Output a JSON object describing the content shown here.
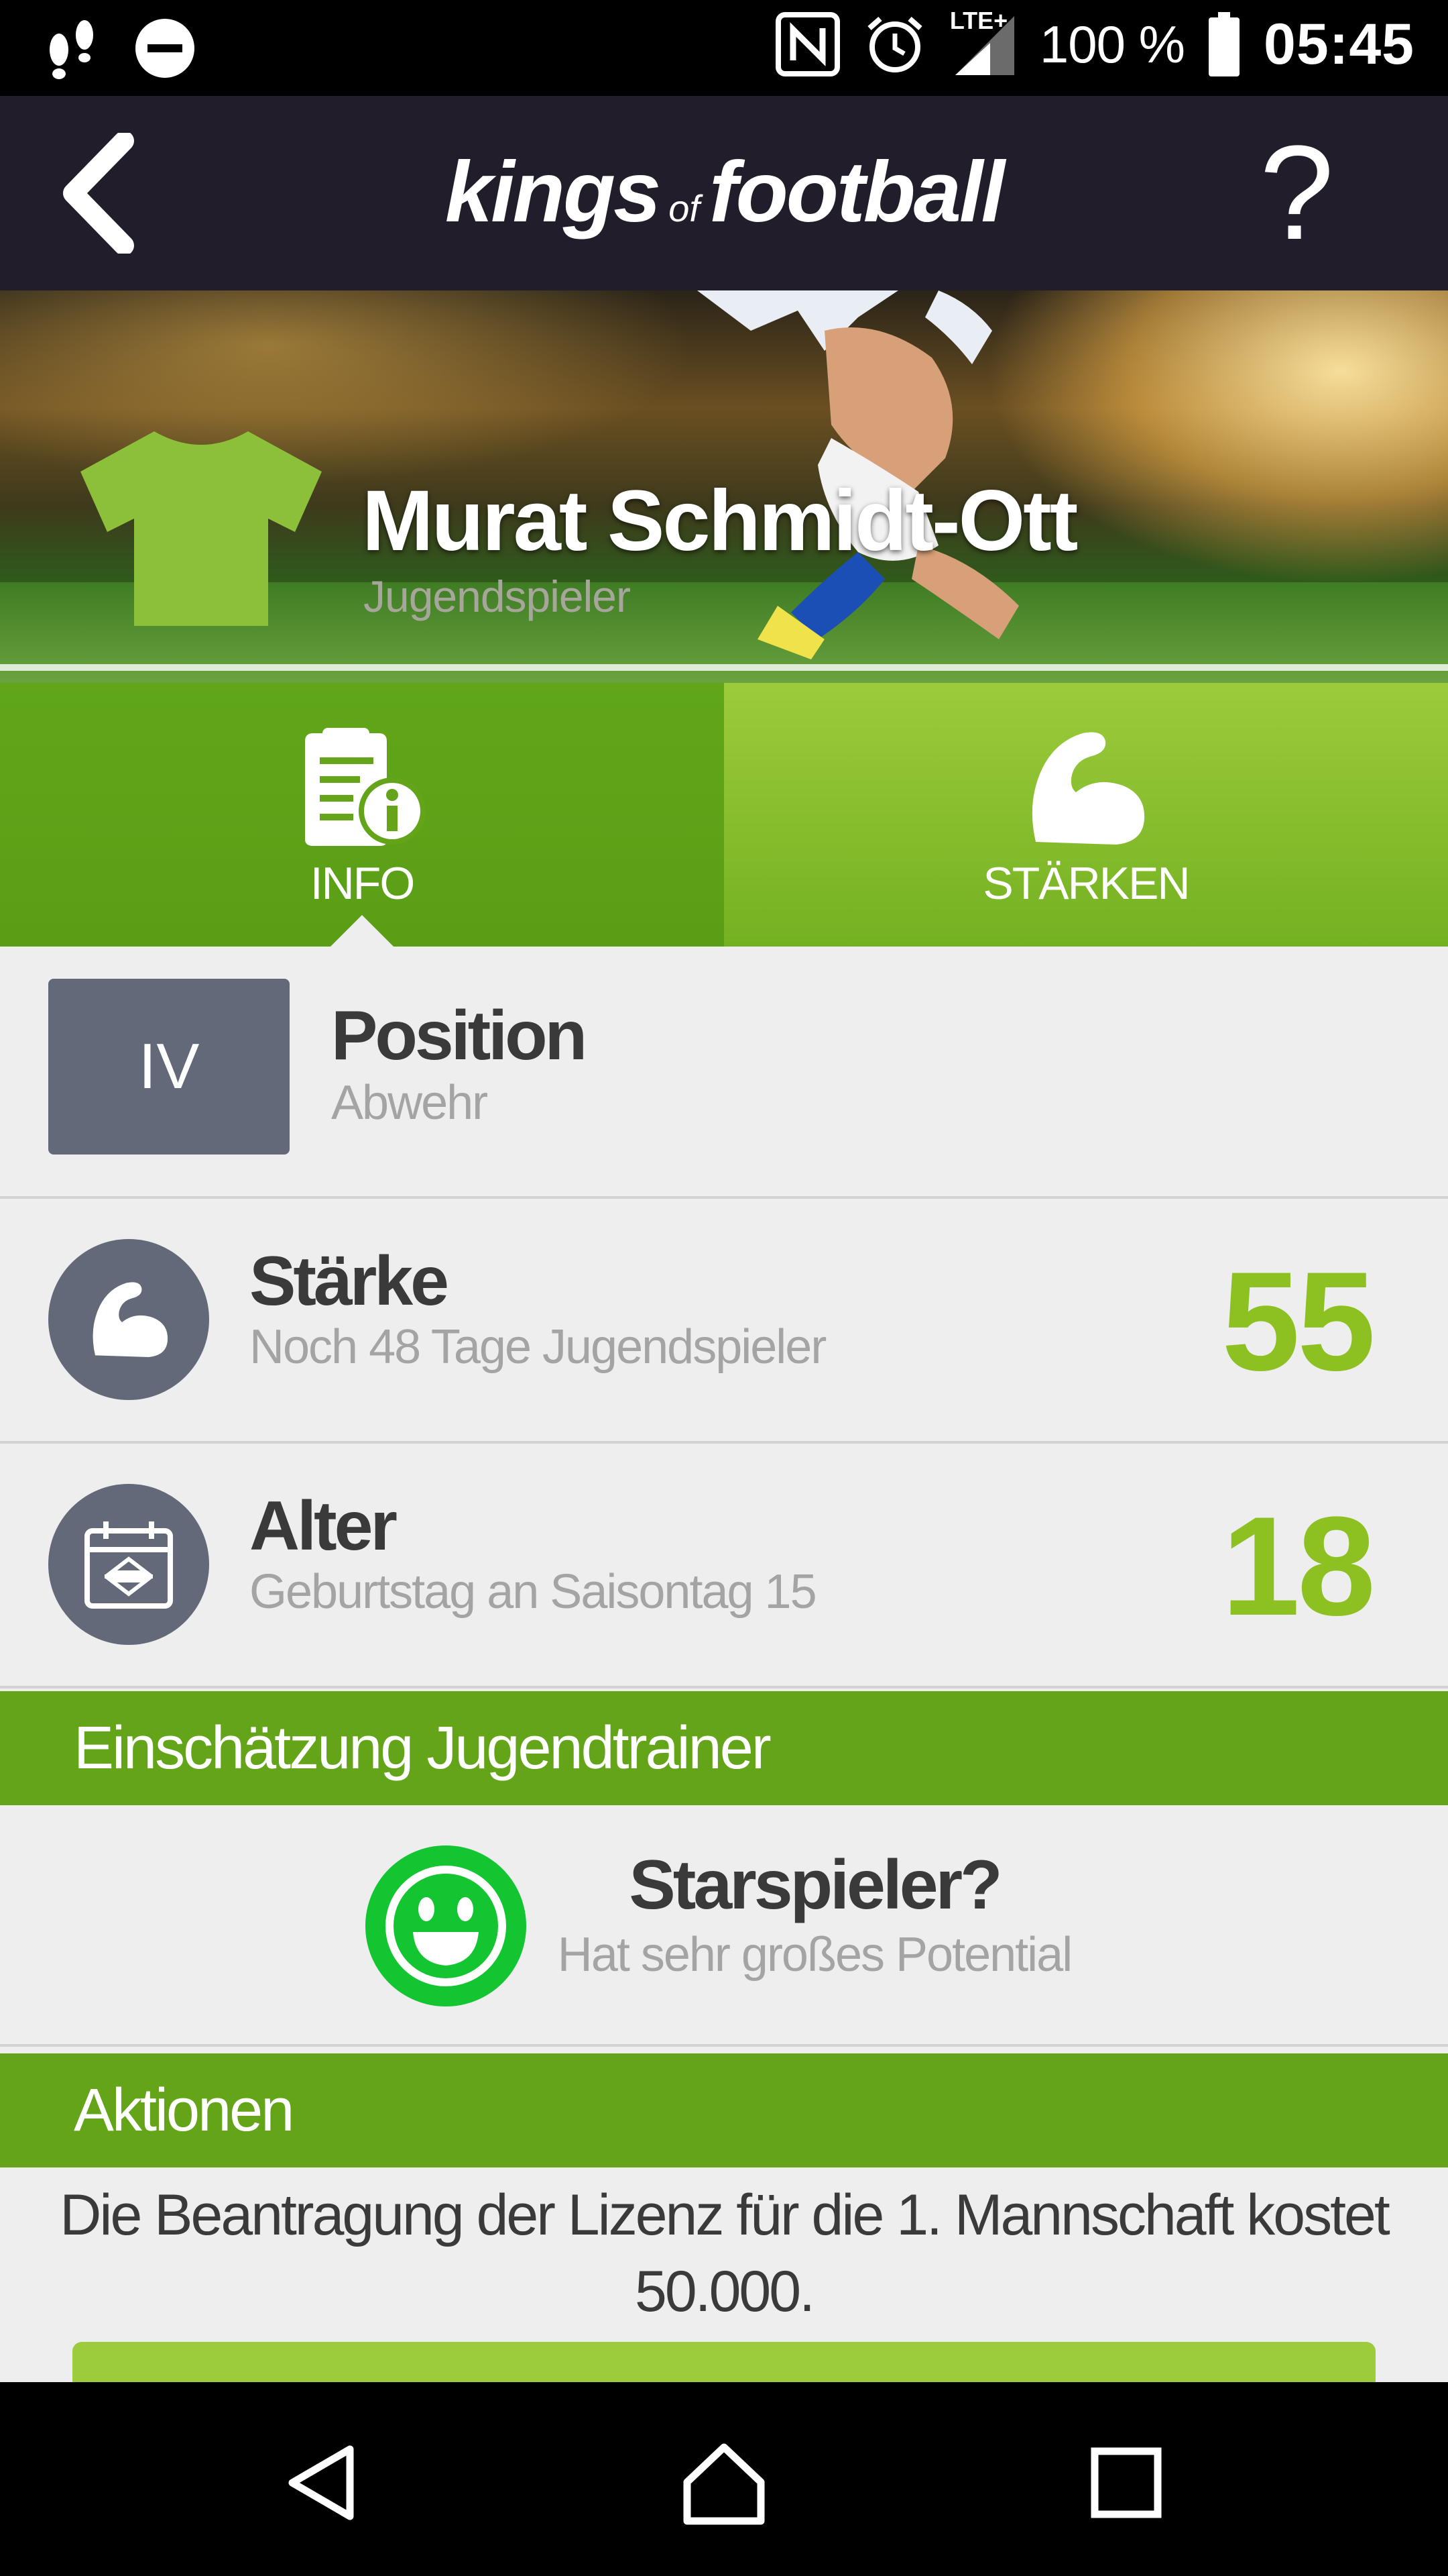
{
  "status_bar": {
    "battery_text": "100 %",
    "time": "05:45",
    "network_label": "LTE+",
    "icons": [
      "footsteps-icon",
      "do-not-disturb-icon",
      "nfc-icon",
      "alarm-icon",
      "signal-icon",
      "battery-icon"
    ]
  },
  "app_bar": {
    "logo_word1": "kings",
    "logo_word2": "of",
    "logo_word3": "football",
    "help_label": "?"
  },
  "player": {
    "name": "Murat Schmidt-Ott",
    "type": "Jugendspieler",
    "shirt_color": "#8dc03a"
  },
  "tabs": [
    {
      "label": "INFO",
      "icon": "info-document-icon",
      "active": true
    },
    {
      "label": "STÄRKEN",
      "icon": "flexed-bicep-icon",
      "active": false
    }
  ],
  "position": {
    "code": "IV",
    "title": "Position",
    "value": "Abwehr"
  },
  "staerke": {
    "title": "Stärke",
    "subtitle": "Noch 48 Tage Jugendspieler",
    "value": "55"
  },
  "alter": {
    "title": "Alter",
    "subtitle": "Geburtstag an Saisontag 15",
    "value": "18"
  },
  "assessment": {
    "heading": "Einschätzung Jugendtrainer",
    "title": "Starspieler?",
    "subtitle": "Hat sehr großes Potential"
  },
  "actions": {
    "heading": "Aktionen",
    "text": "Die Beantragung der Lizenz für die 1. Mannschaft kostet 50.000."
  },
  "colors": {
    "brand_green": "#63a419",
    "value_green": "#8dc021",
    "smiley_green": "#13c530",
    "app_bar": "#221d2a"
  }
}
